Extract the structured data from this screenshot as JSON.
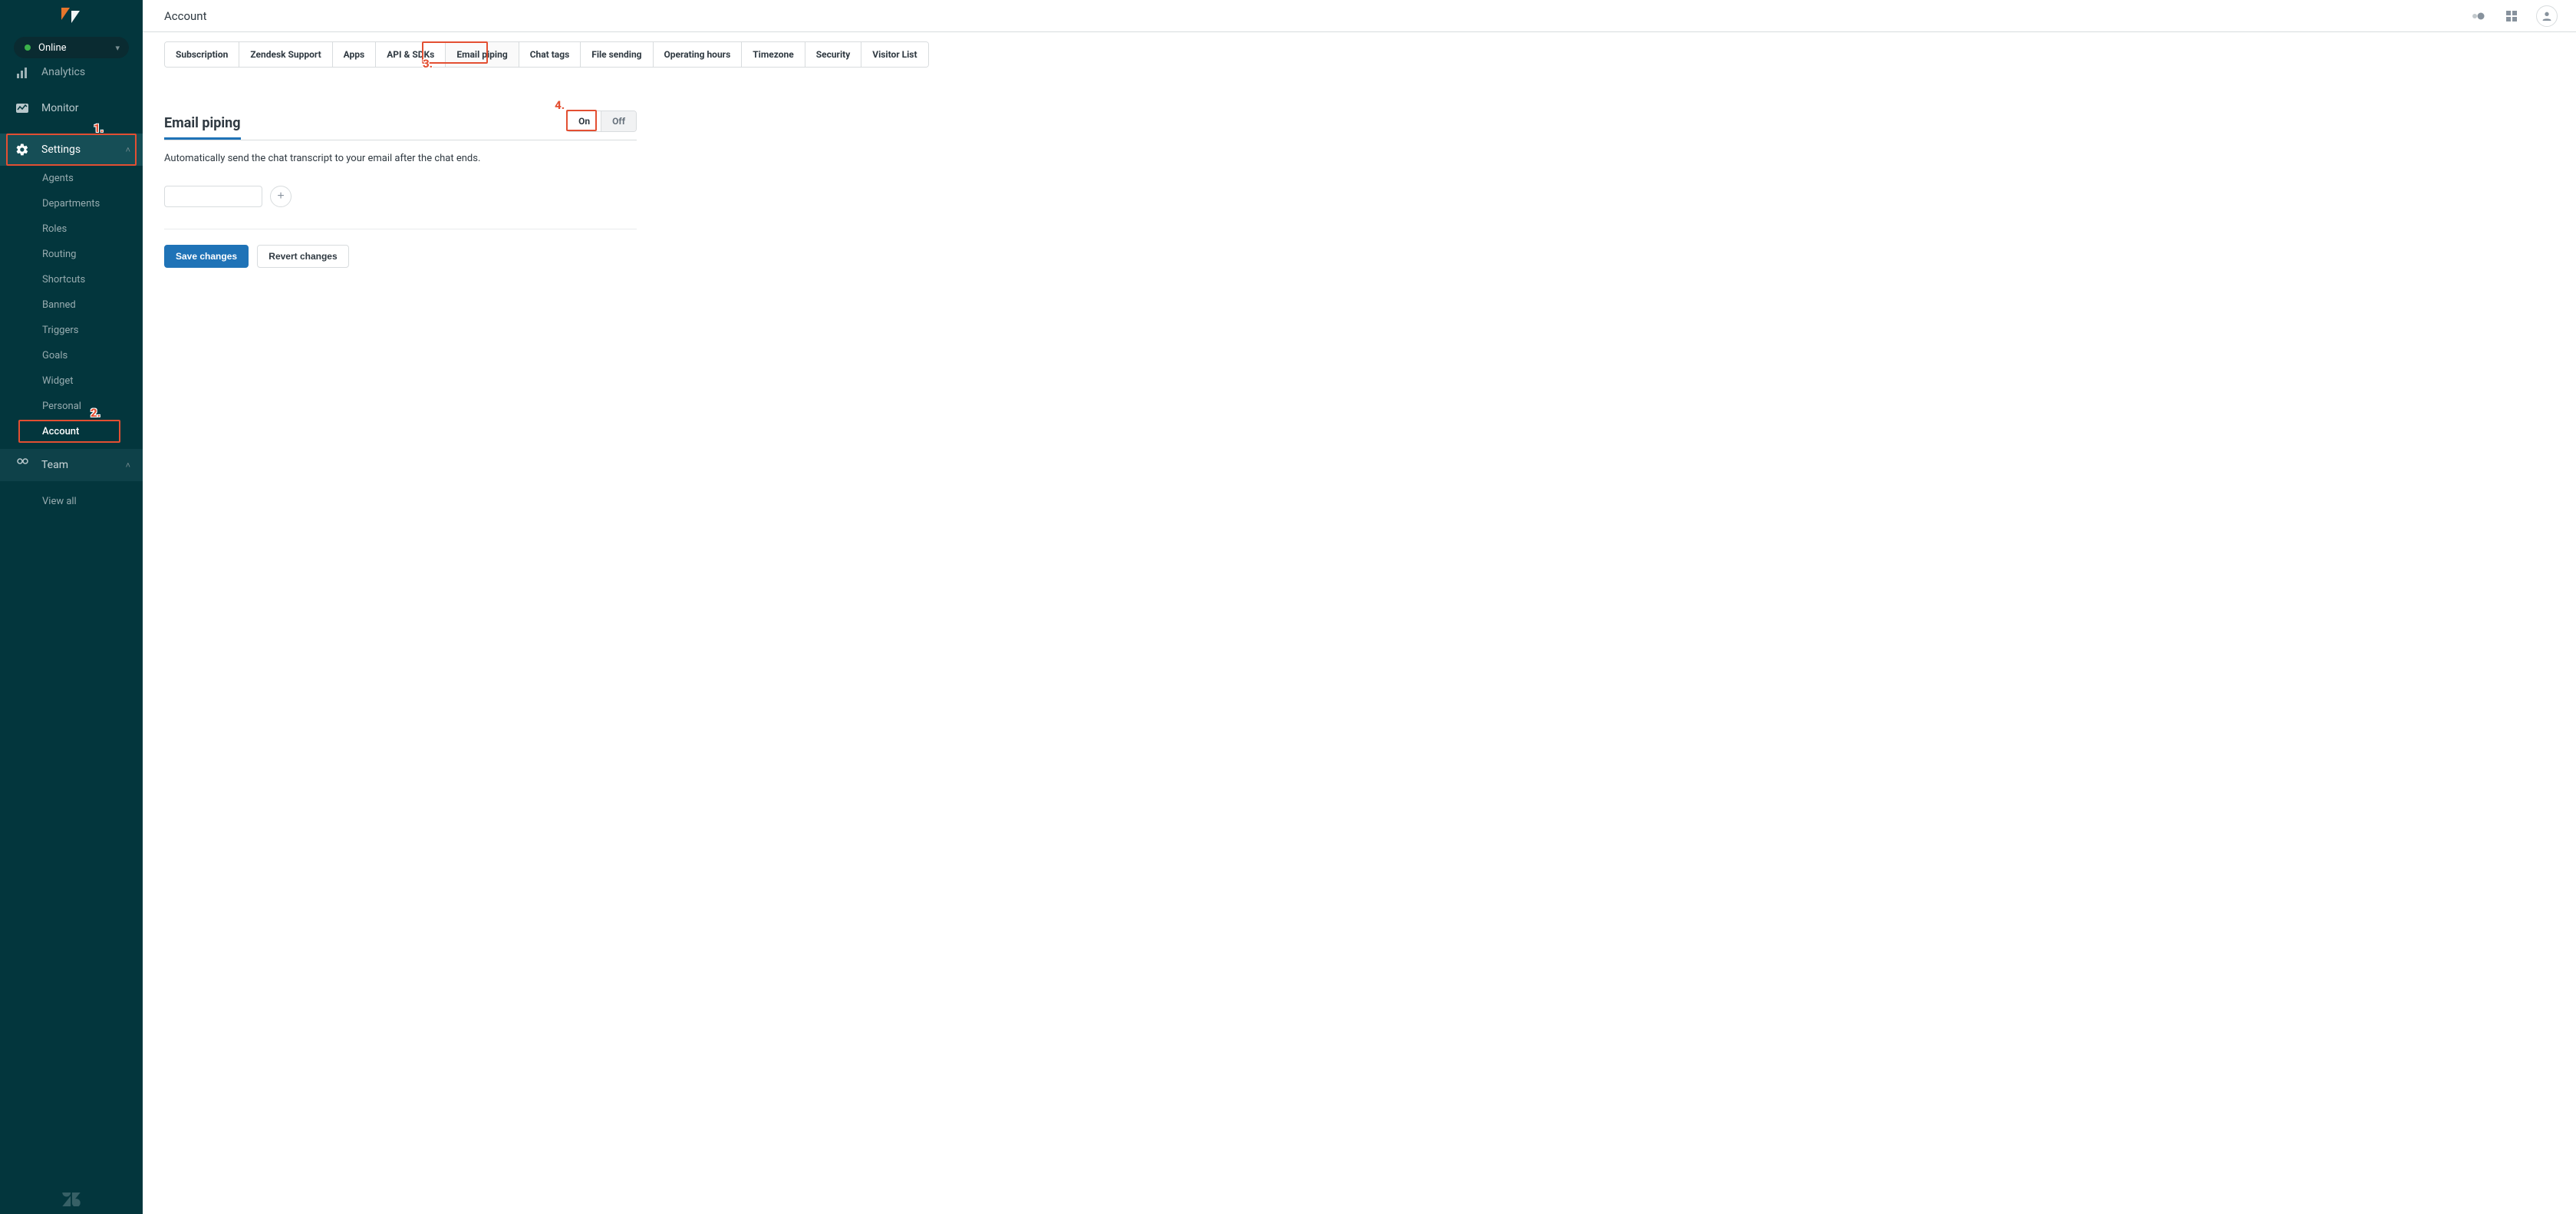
{
  "header": {
    "title": "Account"
  },
  "status": {
    "label": "Online",
    "indicator_color": "#3BB24B"
  },
  "sidebar": {
    "nav": {
      "analytics": "Analytics",
      "monitor": "Monitor",
      "settings": "Settings",
      "team": "Team",
      "view_all": "View all"
    },
    "settings_items": [
      "Agents",
      "Departments",
      "Roles",
      "Routing",
      "Shortcuts",
      "Banned",
      "Triggers",
      "Goals",
      "Widget",
      "Personal",
      "Account"
    ],
    "settings_active_index": 10
  },
  "tabs": {
    "items": [
      "Subscription",
      "Zendesk Support",
      "Apps",
      "API & SDKs",
      "Email piping",
      "Chat tags",
      "File sending",
      "Operating hours",
      "Timezone",
      "Security",
      "Visitor List"
    ],
    "active_index": 4
  },
  "panel": {
    "title": "Email piping",
    "description": "Automatically send the chat transcript to your email after the chat ends.",
    "toggle": {
      "on": "On",
      "off": "Off",
      "value": "on"
    },
    "email_input": {
      "value": "",
      "placeholder": ""
    },
    "buttons": {
      "save": "Save changes",
      "revert": "Revert changes"
    }
  },
  "callouts": {
    "1": "1.",
    "2": "2.",
    "3": "3.",
    "4": "4."
  }
}
